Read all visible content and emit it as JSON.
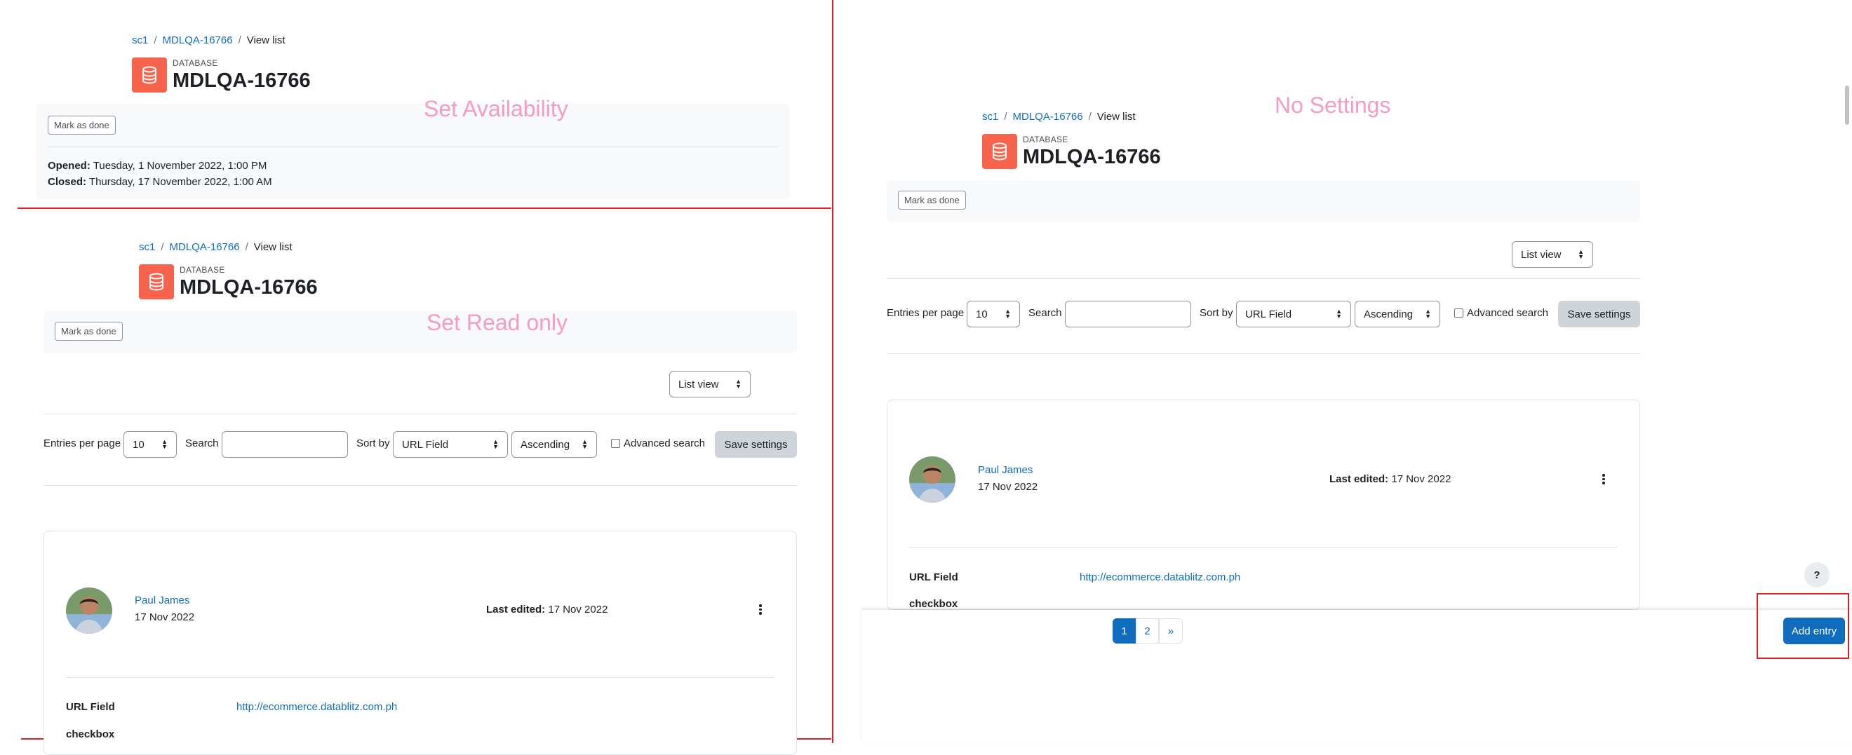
{
  "breadcrumb": {
    "course": "sc1",
    "activity": "MDLQA-16766",
    "current": "View list",
    "sep": "/"
  },
  "header": {
    "module_label": "DATABASE",
    "title": "MDLQA-16766"
  },
  "buttons": {
    "mark_done": "Mark as done",
    "save_settings": "Save settings",
    "add_entry": "Add entry",
    "help": "?"
  },
  "annotations": {
    "availability": "Set Availability",
    "read_only": "Set Read only",
    "no_settings": "No Settings"
  },
  "dates": {
    "opened_label": "Opened:",
    "opened_value": "Tuesday, 1 November 2022, 1:00 PM",
    "closed_label": "Closed:",
    "closed_value": "Thursday, 17 November 2022, 1:00 AM"
  },
  "view": {
    "selected": "List view"
  },
  "controls": {
    "entries_label": "Entries per page",
    "entries_value": "10",
    "search_label": "Search",
    "search_value": "",
    "sort_label": "Sort by",
    "sort_value": "URL Field",
    "order_value": "Ascending",
    "advanced_label": "Advanced search"
  },
  "entry": {
    "author": "Paul James",
    "date": "17 Nov 2022",
    "last_edited_label": "Last edited:",
    "last_edited_value": "17 Nov 2022",
    "url_field_label": "URL Field",
    "url_value": "http://ecommerce.datablitz.com.ph",
    "checkbox_label": "checkbox"
  },
  "pagination": {
    "page1": "1",
    "page2": "2",
    "next": "»"
  },
  "colors": {
    "accent": "#0f6cbf",
    "db_icon": "#f7634d",
    "annotation": "#f49cc3",
    "divider": "#e21f26"
  }
}
